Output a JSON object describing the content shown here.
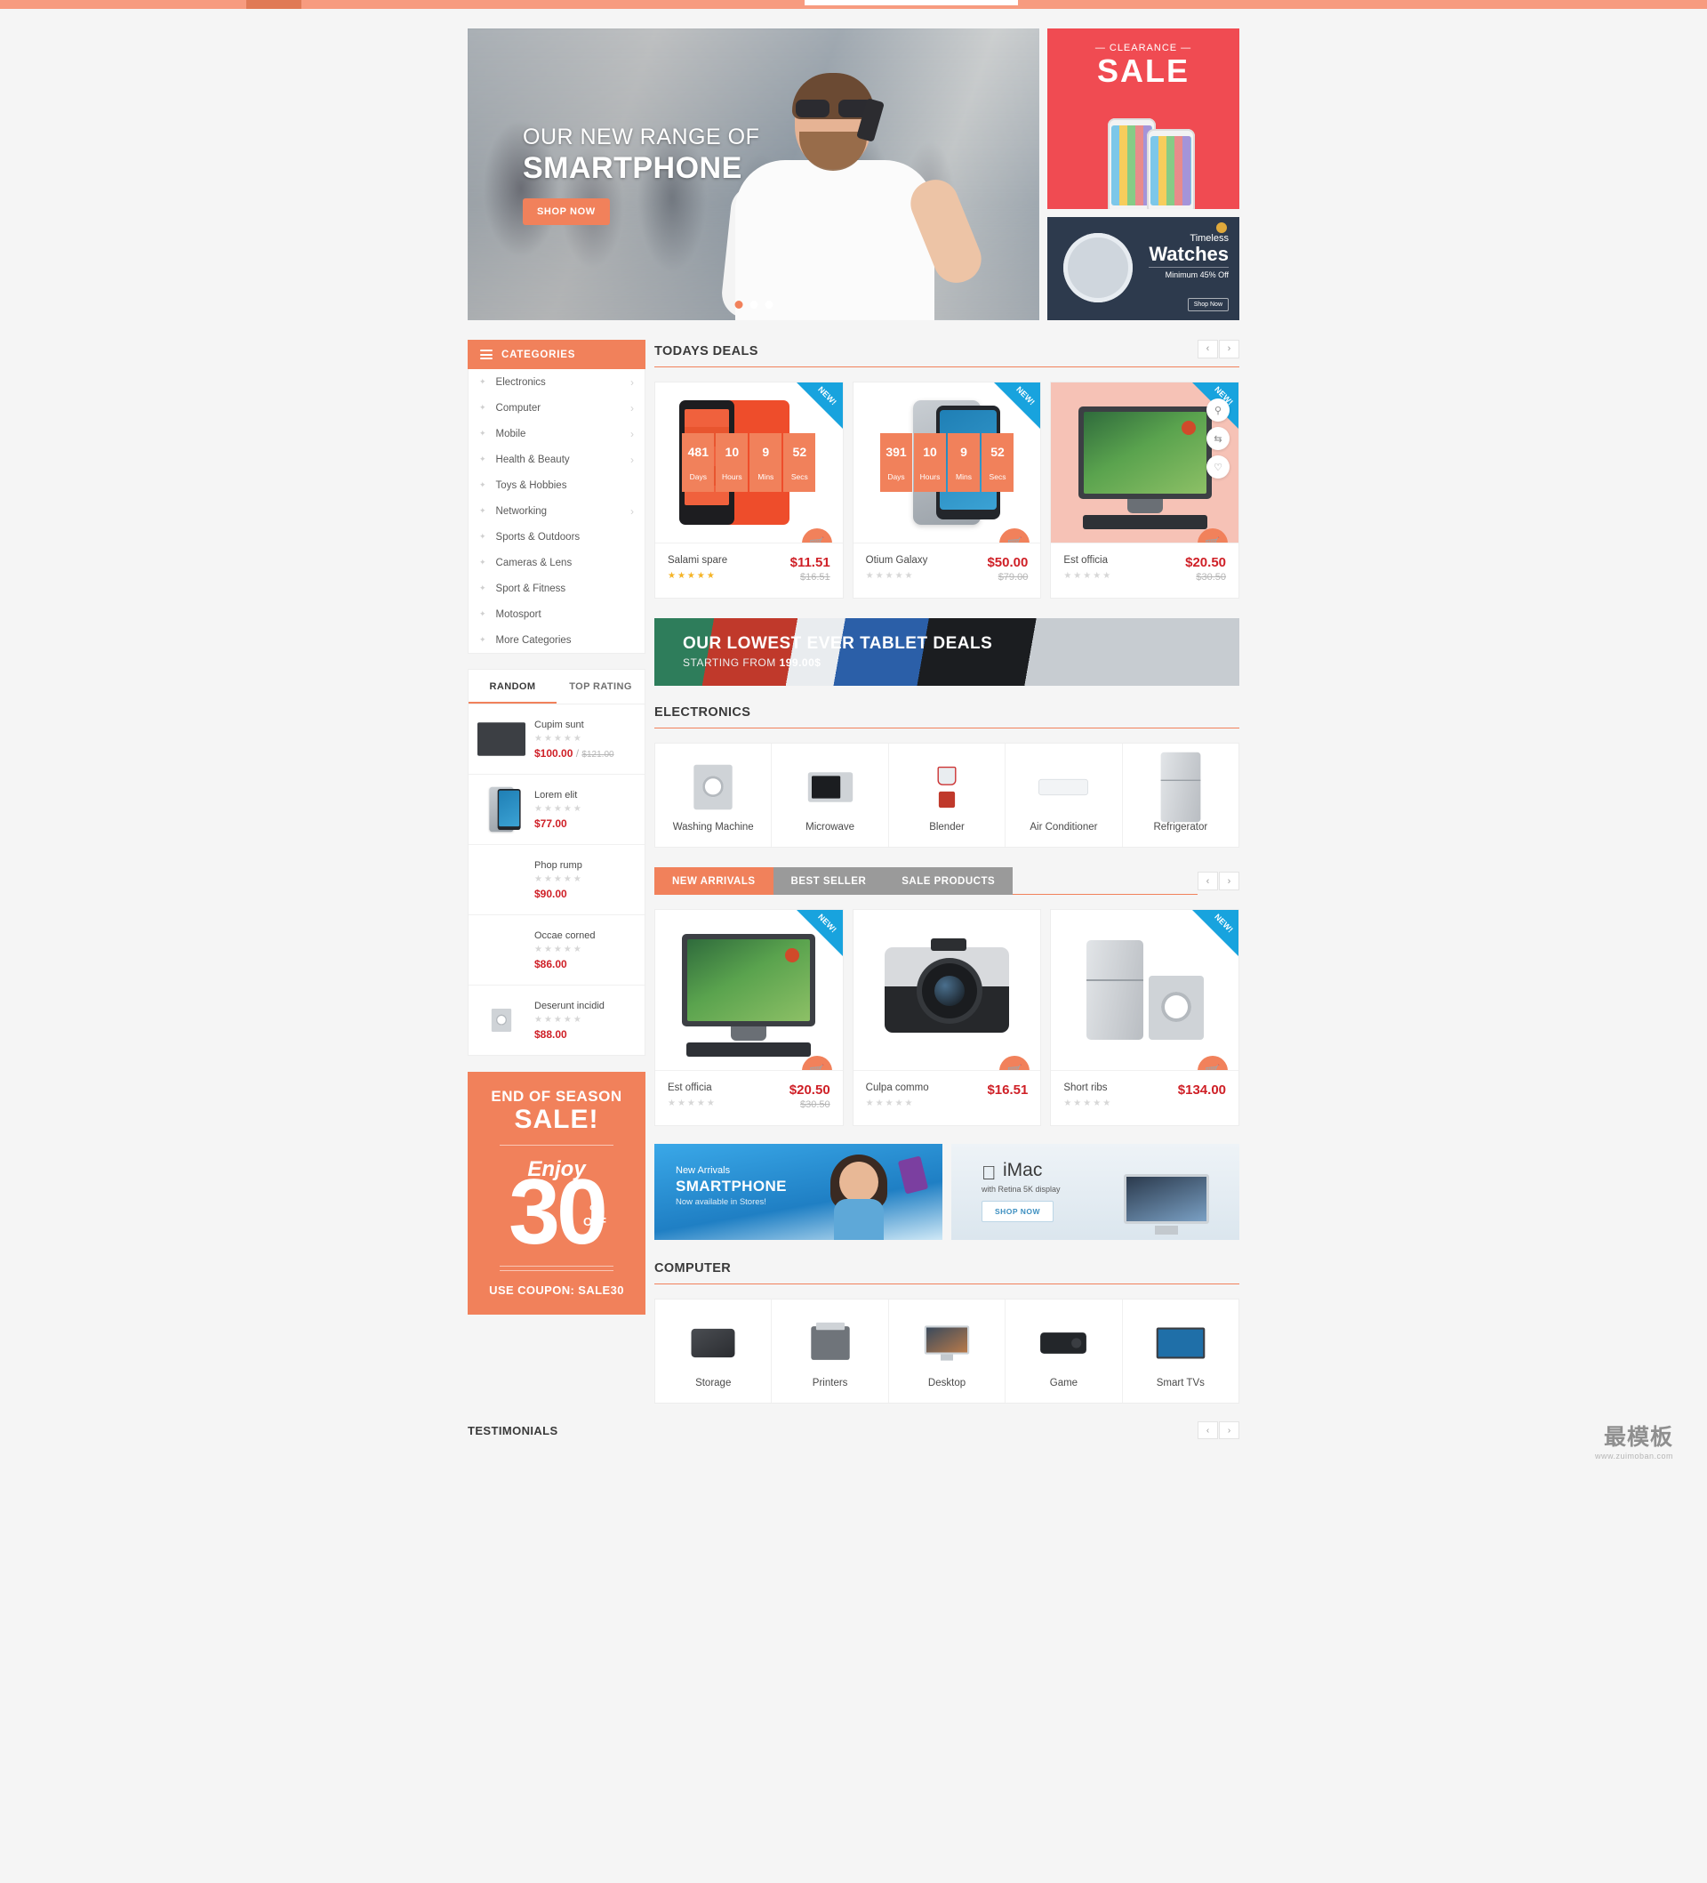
{
  "hero": {
    "line1": "OUR NEW RANGE OF",
    "line2": "SMARTPHONE",
    "cta": "SHOP NOW ",
    "dots": 3
  },
  "promos": {
    "clearance": {
      "small": "— CLEARANCE —",
      "big": "SALE"
    },
    "watch": {
      "t1": "Timeless",
      "t2": "Watches",
      "t3": "Minimum 45% Off",
      "btn": "Shop Now "
    }
  },
  "sidebar": {
    "categories_title": "CATEGORIES",
    "categories": [
      {
        "label": "Electronics",
        "arrow": true
      },
      {
        "label": "Computer",
        "arrow": true
      },
      {
        "label": "Mobile",
        "arrow": true
      },
      {
        "label": "Health & Beauty",
        "arrow": true
      },
      {
        "label": "Toys & Hobbies",
        "arrow": false
      },
      {
        "label": "Networking",
        "arrow": true
      },
      {
        "label": "Sports & Outdoors",
        "arrow": false
      },
      {
        "label": "Cameras & Lens",
        "arrow": false
      },
      {
        "label": "Sport & Fitness",
        "arrow": false
      },
      {
        "label": "Motosport",
        "arrow": false
      },
      {
        "label": "More Categories",
        "arrow": false
      }
    ],
    "tabs": [
      {
        "label": "RANDOM",
        "active": true
      },
      {
        "label": "TOP RATING",
        "active": false
      }
    ],
    "products": [
      {
        "name": "Cupim sunt",
        "price": "$100.00",
        "old": "$121.00",
        "stars": 0
      },
      {
        "name": "Lorem elit",
        "price": "$77.00",
        "old": "",
        "stars": 0
      },
      {
        "name": "Phop rump",
        "price": "$90.00",
        "old": "",
        "stars": 0
      },
      {
        "name": "Occae corned",
        "price": "$86.00",
        "old": "",
        "stars": 0
      },
      {
        "name": "Deserunt incidid",
        "price": "$88.00",
        "old": "",
        "stars": 0
      }
    ],
    "season": {
      "l1": "END OF SEASON",
      "l2": "SALE!",
      "enjoy": "Enjoy",
      "number": "30",
      "pct": "%",
      "off": "OFF",
      "coupon": "USE COUPON: SALE30"
    }
  },
  "todays_deals": {
    "title": "TODAYS DEALS",
    "prev": "‹",
    "next": "›",
    "products": [
      {
        "name": "Salami spare",
        "price": "$11.51",
        "old": "$16.51",
        "stars": 5,
        "badge": "NEW!",
        "timer": [
          {
            "n": "481",
            "u": "Days"
          },
          {
            "n": "10",
            "u": "Hours"
          },
          {
            "n": "9",
            "u": "Mins"
          },
          {
            "n": "52",
            "u": "Secs"
          }
        ]
      },
      {
        "name": "Otium Galaxy",
        "price": "$50.00",
        "old": "$79.00",
        "stars": 0,
        "badge": "NEW!",
        "timer": [
          {
            "n": "391",
            "u": "Days"
          },
          {
            "n": "10",
            "u": "Hours"
          },
          {
            "n": "9",
            "u": "Mins"
          },
          {
            "n": "52",
            "u": "Secs"
          }
        ]
      },
      {
        "name": "Est officia",
        "price": "$20.50",
        "old": "$30.50",
        "stars": 0,
        "badge": "NEW!",
        "timer": []
      }
    ]
  },
  "tablet_banner": {
    "title": "OUR LOWEST EVER TABLET DEALS",
    "sub_prefix": "STARTING FROM ",
    "sub_price": "199.00$"
  },
  "electronics": {
    "title": "ELECTRONICS",
    "items": [
      {
        "label": "Washing Machine",
        "icon": "washing-machine-icon"
      },
      {
        "label": "Microwave",
        "icon": "microwave-icon"
      },
      {
        "label": "Blender",
        "icon": "blender-icon"
      },
      {
        "label": "Air Conditioner",
        "icon": "air-conditioner-icon"
      },
      {
        "label": "Refrigerator",
        "icon": "refrigerator-icon"
      }
    ]
  },
  "arrivals": {
    "tabs": [
      {
        "label": "NEW ARRIVALS",
        "active": true
      },
      {
        "label": "BEST SELLER",
        "active": false
      },
      {
        "label": "SALE PRODUCTS",
        "active": false
      }
    ],
    "prev": "‹",
    "next": "›",
    "products": [
      {
        "name": "Est officia",
        "price": "$20.50",
        "old": "$30.50",
        "stars": 0,
        "badge": "NEW!"
      },
      {
        "name": "Culpa commo",
        "price": "$16.51",
        "old": "",
        "stars": 0,
        "badge": ""
      },
      {
        "name": "Short ribs",
        "price": "$134.00",
        "old": "",
        "stars": 0,
        "badge": "NEW!"
      }
    ]
  },
  "ads": {
    "smartphone": {
      "l1": "New Arrivals",
      "l2": "SMARTPHONE",
      "l3": "Now available in Stores!"
    },
    "imac": {
      "apple": "",
      "name": "iMac",
      "sub": "with Retina 5K display",
      "btn": "SHOP NOW"
    }
  },
  "computer": {
    "title": "COMPUTER",
    "items": [
      {
        "label": "Storage",
        "icon": "hard-drive-icon"
      },
      {
        "label": "Printers",
        "icon": "printer-icon"
      },
      {
        "label": "Desktop",
        "icon": "desktop-icon"
      },
      {
        "label": "Game",
        "icon": "game-console-icon"
      },
      {
        "label": "Smart TVs",
        "icon": "tv-icon"
      }
    ]
  },
  "testimonials": {
    "title": "TESTIMONIALS",
    "prev": "‹",
    "next": "›"
  },
  "watermark": {
    "cn": "最模板",
    "url": "www.zuimoban.com"
  },
  "colors": {
    "accent": "#f1815b",
    "price": "#cf2027",
    "badge": "#18a3de",
    "clearance": "#f04b52"
  }
}
